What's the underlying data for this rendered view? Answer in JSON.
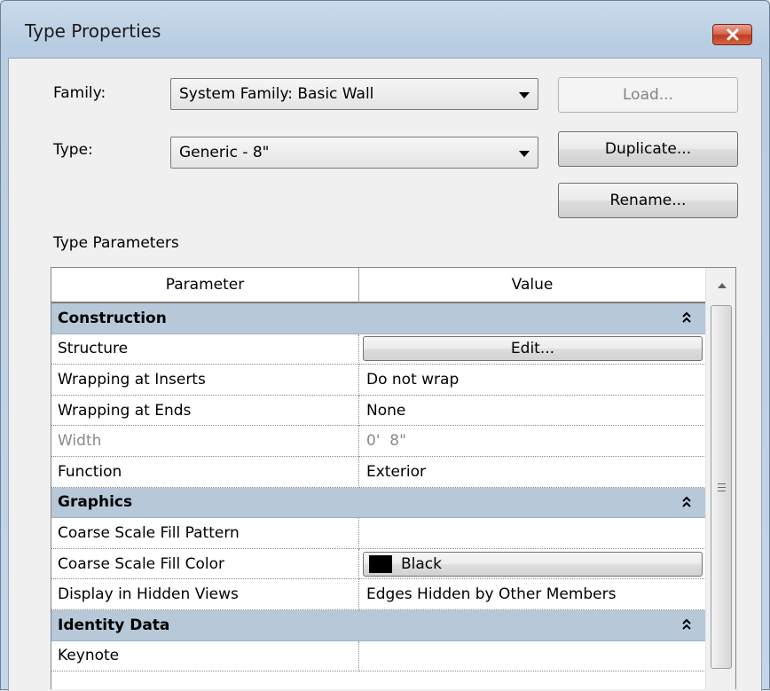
{
  "window": {
    "title": "Type Properties"
  },
  "form": {
    "family_label": "Family:",
    "family_value": "System Family: Basic Wall",
    "type_label": "Type:",
    "type_value": "Generic - 8\"",
    "load_label": "Load...",
    "duplicate_label": "Duplicate...",
    "rename_label": "Rename..."
  },
  "section_label": "Type Parameters",
  "table": {
    "headers": [
      "Parameter",
      "Value"
    ],
    "groups": [
      {
        "name": "Construction",
        "rows": [
          {
            "param": "Structure",
            "value": "Edit..."
          },
          {
            "param": "Wrapping at Inserts",
            "value": "Do not wrap"
          },
          {
            "param": "Wrapping at Ends",
            "value": "None"
          },
          {
            "param": "Width",
            "value": "0'  8\""
          },
          {
            "param": "Function",
            "value": "Exterior"
          }
        ]
      },
      {
        "name": "Graphics",
        "rows": [
          {
            "param": "Coarse Scale Fill Pattern",
            "value": ""
          },
          {
            "param": "Coarse Scale Fill Color",
            "value": "Black"
          },
          {
            "param": "Display in Hidden Views",
            "value": "Edges Hidden by Other Members"
          }
        ]
      },
      {
        "name": "Identity Data",
        "rows": [
          {
            "param": "Keynote",
            "value": ""
          }
        ]
      }
    ]
  },
  "colors": {
    "group_header_bg": "#b7c8d9",
    "close_button": "#c23a1d",
    "fill_color_swatch": "#000000"
  }
}
